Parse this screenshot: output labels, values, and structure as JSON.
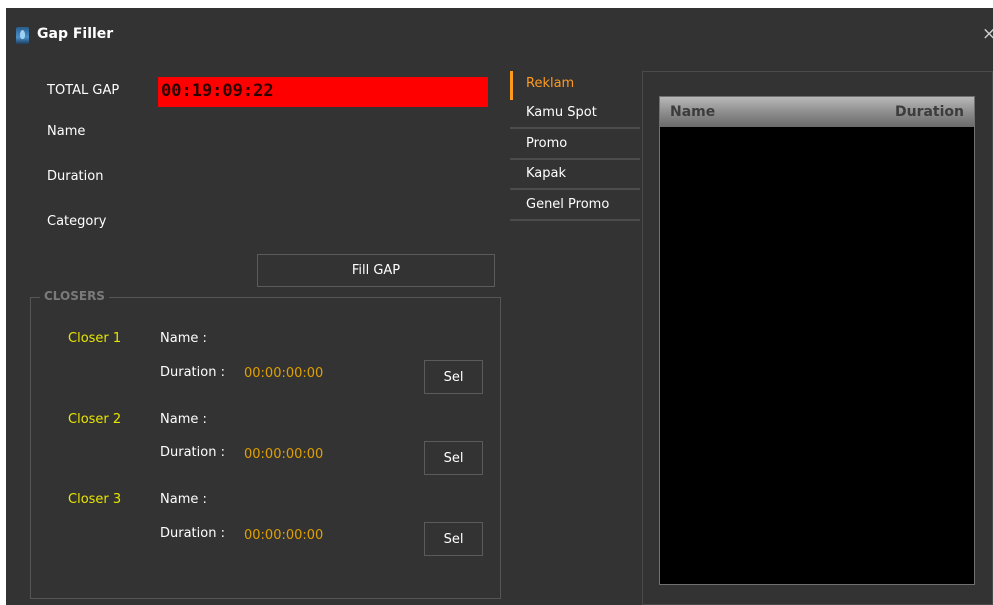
{
  "window": {
    "title": "Gap Filler",
    "close_glyph": "×",
    "icon": "app-icon"
  },
  "info": {
    "total_gap_label": "TOTAL GAP",
    "total_gap_value": "00:19:09:22",
    "name_label": "Name",
    "duration_label": "Duration",
    "category_label": "Category"
  },
  "fill_button_label": "Fill GAP",
  "closers": {
    "legend": "CLOSERS",
    "items": [
      {
        "label": "Closer 1",
        "name_label": "Name :",
        "duration_label": "Duration :",
        "duration_value": "00:00:00:00",
        "select_label": "Sel"
      },
      {
        "label": "Closer 2",
        "name_label": "Name :",
        "duration_label": "Duration :",
        "duration_value": "00:00:00:00",
        "select_label": "Sel"
      },
      {
        "label": "Closer 3",
        "name_label": "Name :",
        "duration_label": "Duration :",
        "duration_value": "00:00:00:00",
        "select_label": "Sel"
      }
    ]
  },
  "tabs": [
    {
      "label": "Reklam",
      "active": true
    },
    {
      "label": "Kamu Spot",
      "active": false
    },
    {
      "label": "Promo",
      "active": false
    },
    {
      "label": "Kapak",
      "active": false
    },
    {
      "label": "Genel Promo",
      "active": false
    }
  ],
  "grid": {
    "columns": [
      "Name",
      "Duration"
    ],
    "rows": []
  },
  "colors": {
    "background": "#333333",
    "gap_highlight": "#ff0000",
    "active_tab": "#ff9a20",
    "closer_label": "#e8e600",
    "duration_value": "#e0a000",
    "grid_background": "#000000"
  }
}
